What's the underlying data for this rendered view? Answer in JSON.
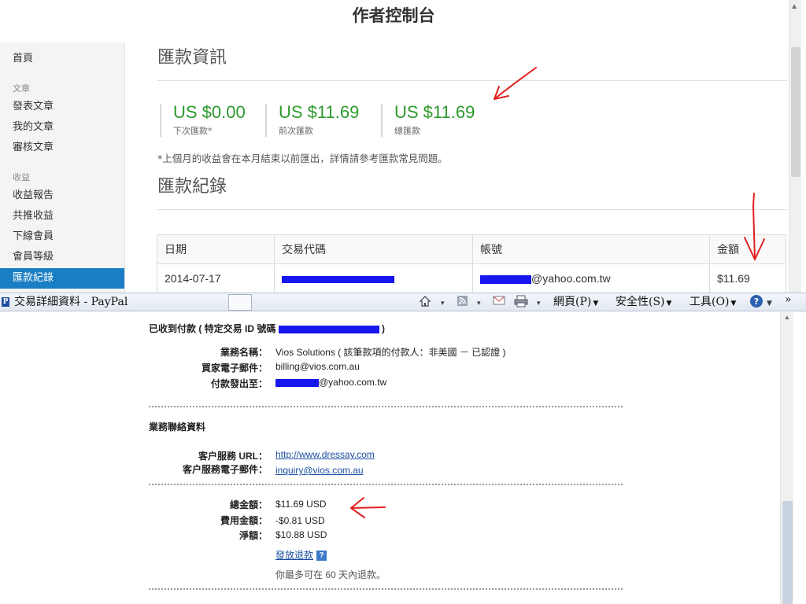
{
  "dashboard": {
    "title": "作者控制台",
    "sidebar": {
      "home": "首頁",
      "section_articles": "文章",
      "publish": "發表文章",
      "my_articles": "我的文章",
      "review": "審核文章",
      "section_earnings": "收益",
      "earnings_report": "收益報告",
      "co_promo": "共推收益",
      "downline": "下線會員",
      "member_level": "會員等級",
      "remittance_records": "匯款紀錄"
    },
    "remit_info_heading": "匯款資訊",
    "stats": [
      {
        "amount": "US $0.00",
        "label": "下次匯款*"
      },
      {
        "amount": "US $11.69",
        "label": "前次匯款"
      },
      {
        "amount": "US $11.69",
        "label": "總匯款"
      }
    ],
    "note": "*上個月的收益會在本月結束以前匯出，詳情請參考匯款常見問題。",
    "records_heading": "匯款紀錄",
    "table": {
      "headers": [
        "日期",
        "交易代碼",
        "帳號",
        "金額"
      ],
      "rows": [
        {
          "date": "2014-07-17",
          "account_suffix": "@yahoo.com.tw",
          "amount": "$11.69"
        }
      ]
    }
  },
  "browser": {
    "tab_title": "交易詳細資料 - PayPal",
    "menu": {
      "page": "網頁(P)",
      "safety": "安全性(S)",
      "tools": "工具(O)",
      "more": "»"
    }
  },
  "paypal": {
    "received_title": "已收到付款 ( 特定交易 ID 號碼",
    "received_close": ")",
    "business_name_label": "業務名稱：",
    "business_name_value": "Vios Solutions ( 該筆款項的付款人：非美國 － 已認證 )",
    "buyer_email_label": "買家電子郵件：",
    "buyer_email_value": "billing@vios.com.au",
    "paid_to_label": "付款發出至：",
    "paid_to_suffix": "@yahoo.com.tw",
    "contact_section": "業務聯絡資料",
    "cs_url_label": "客户服務 URL：",
    "cs_url_value": "http://www.dressay.com",
    "cs_email_label": "客户服務電子郵件：",
    "cs_email_value": "inquiry@vios.com.au",
    "total_label": "總金額：",
    "total_value": "$11.69 USD",
    "fee_label": "費用金額：",
    "fee_value": "-$0.81 USD",
    "net_label": "淨額：",
    "net_value": "$10.88 USD",
    "refund_link": "發放退款",
    "refund_note": "你最多可在 60 天內退款。"
  },
  "colors": {
    "accent_blue": "#1a7ec4",
    "amount_green": "#2c9a2c",
    "annotation_red": "#e02020",
    "redaction_blue": "#1616ee"
  },
  "icons": [
    "home-icon",
    "rss-feed-icon",
    "mail-icon",
    "print-icon",
    "help-icon"
  ]
}
